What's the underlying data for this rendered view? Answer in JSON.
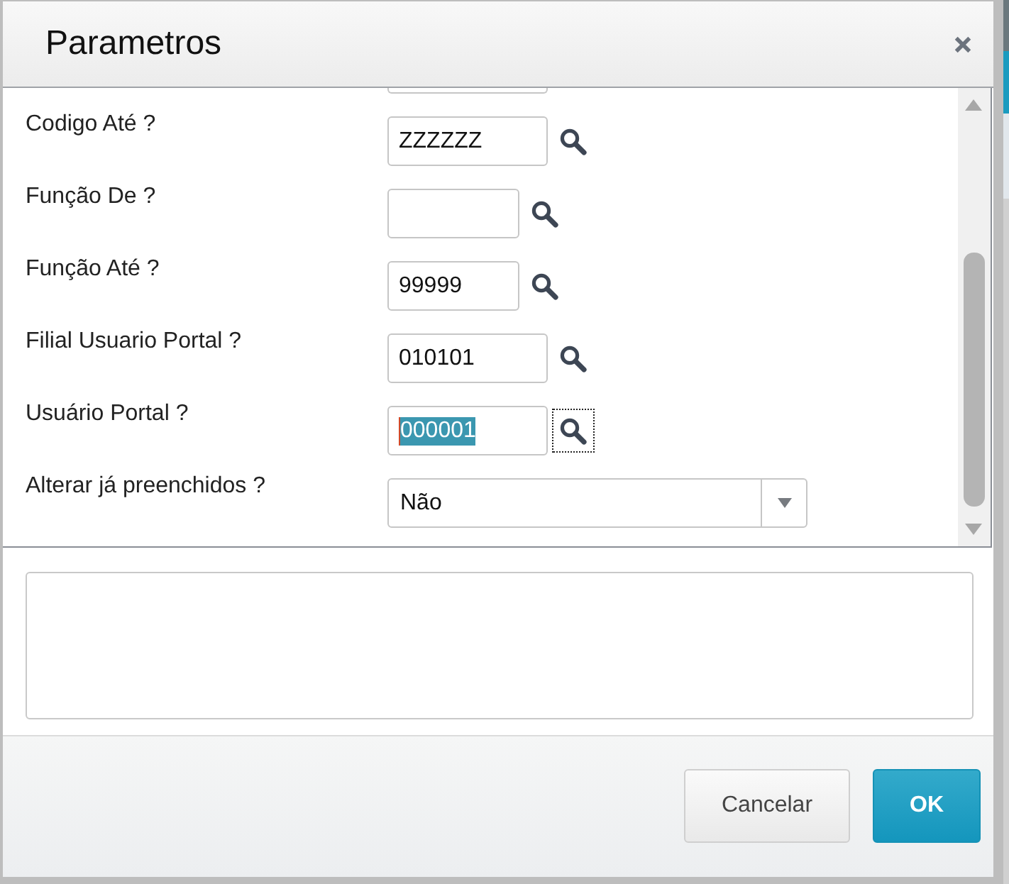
{
  "dialog": {
    "title": "Parametros"
  },
  "fields": [
    {
      "kind": "text",
      "label": "Codigo Até ?",
      "value": "ZZZZZZ",
      "text_selected": false,
      "lookup_focused": false
    },
    {
      "kind": "text",
      "label": "Função De ?",
      "lookup_focused": false
    },
    {
      "kind": "text",
      "label": "Função Até ?",
      "value": "99999",
      "text_selected": false,
      "lookup_focused": false
    },
    {
      "kind": "text",
      "label": "Filial Usuario Portal ?",
      "value": "010101",
      "text_selected": false,
      "lookup_focused": false
    },
    {
      "kind": "text",
      "label": "Usuário Portal ?",
      "value": "000001",
      "text_selected": true,
      "lookup_focused": true
    },
    {
      "kind": "select",
      "label": "Alterar já preenchidos ?",
      "value": "Não"
    }
  ],
  "buttons": [
    {
      "kind": "secondary",
      "label": "Cancelar"
    },
    {
      "kind": "primary",
      "label": "OK"
    }
  ]
}
